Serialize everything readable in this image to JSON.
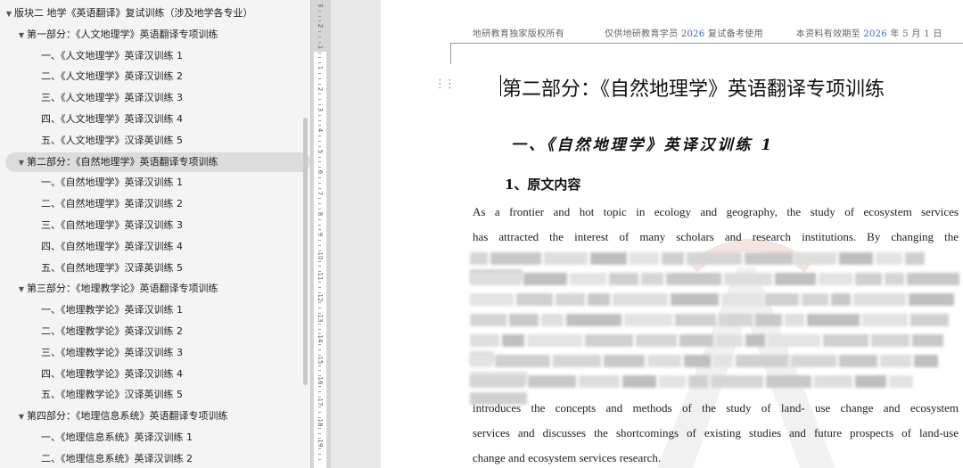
{
  "nav": {
    "items": [
      {
        "level": 0,
        "caret": "▼",
        "label": "版块二 地学《英语翻译》复试训练（涉及地学各专业）"
      },
      {
        "level": 1,
        "caret": "▼",
        "label": "第一部分：《人文地理学》英语翻译专项训练"
      },
      {
        "level": 2,
        "caret": "",
        "label": "一、《人文地理学》英译汉训练 1"
      },
      {
        "level": 2,
        "caret": "",
        "label": "二、《人文地理学》英译汉训练 2"
      },
      {
        "level": 2,
        "caret": "",
        "label": "三、《人文地理学》英译汉训练 3"
      },
      {
        "level": 2,
        "caret": "",
        "label": "四、《人文地理学》英译汉训练 4"
      },
      {
        "level": 2,
        "caret": "",
        "label": "五、《人文地理学》汉译英训练 5"
      },
      {
        "level": 1,
        "caret": "▼",
        "label": "第二部分：《自然地理学》英语翻译专项训练",
        "selected": true
      },
      {
        "level": 2,
        "caret": "",
        "label": "一、《自然地理学》英译汉训练 1"
      },
      {
        "level": 2,
        "caret": "",
        "label": "二、《自然地理学》英译汉训练 2"
      },
      {
        "level": 2,
        "caret": "",
        "label": "三、《自然地理学》英译汉训练 3"
      },
      {
        "level": 2,
        "caret": "",
        "label": "四、《自然地理学》英译汉训练 4"
      },
      {
        "level": 2,
        "caret": "",
        "label": "五、《自然地理学》汉译英训练 5"
      },
      {
        "level": 1,
        "caret": "▼",
        "label": "第三部分：《地理教学论》英语翻译专项训练"
      },
      {
        "level": 2,
        "caret": "",
        "label": "一、《地理教学论》英译汉训练 1"
      },
      {
        "level": 2,
        "caret": "",
        "label": "二、《地理教学论》英译汉训练 2"
      },
      {
        "level": 2,
        "caret": "",
        "label": "三、《地理教学论》英译汉训练 3"
      },
      {
        "level": 2,
        "caret": "",
        "label": "四、《地理教学论》英译汉训练 4"
      },
      {
        "level": 2,
        "caret": "",
        "label": "五、《地理教学论》汉译英训练 5"
      },
      {
        "level": 1,
        "caret": "▼",
        "label": "第四部分：《地理信息系统》英语翻译专项训练"
      },
      {
        "level": 2,
        "caret": "",
        "label": "一、《地理信息系统》英译汉训练 1"
      },
      {
        "level": 2,
        "caret": "",
        "label": "二、《地理信息系统》英译汉训练 2"
      }
    ]
  },
  "ruler": {
    "numbers": [
      "3",
      "2",
      "1",
      "1",
      "2",
      "3",
      "4",
      "5",
      "6",
      "7",
      "8",
      "9",
      "10",
      "11",
      "12",
      "13",
      "14",
      "15",
      "16",
      "17",
      "18",
      "19"
    ]
  },
  "doc": {
    "header": {
      "part1": "地研教育独家版权所有",
      "part2a": "仅供地研教育学员 ",
      "part2b": "2026",
      "part2c": " 复试备考使用",
      "part3a": "本资料有效期至 ",
      "part3b": "2026",
      "part3c": " 年 5 月 1 日"
    },
    "part_title": "第二部分：《自然地理学》英语翻译专项训练",
    "section_title": "一、《自然地理学》英译汉训练 1",
    "sub_title": "1、原文内容",
    "para_top": [
      "As a frontier and hot topic in ecology and geography, the study of ecosystem services",
      "has attracted the interest of many scholars and research institutions. By changing the"
    ],
    "para_bottom": [
      "introduces the concepts and methods of the study of land- use change and ecosystem",
      "services and discusses the shortcomings of existing studies and future prospects of land-use",
      "change and ecosystem services research."
    ]
  },
  "colors": {
    "accent_blue": "#3a66c4",
    "selected_bg": "#dcdcdd"
  }
}
